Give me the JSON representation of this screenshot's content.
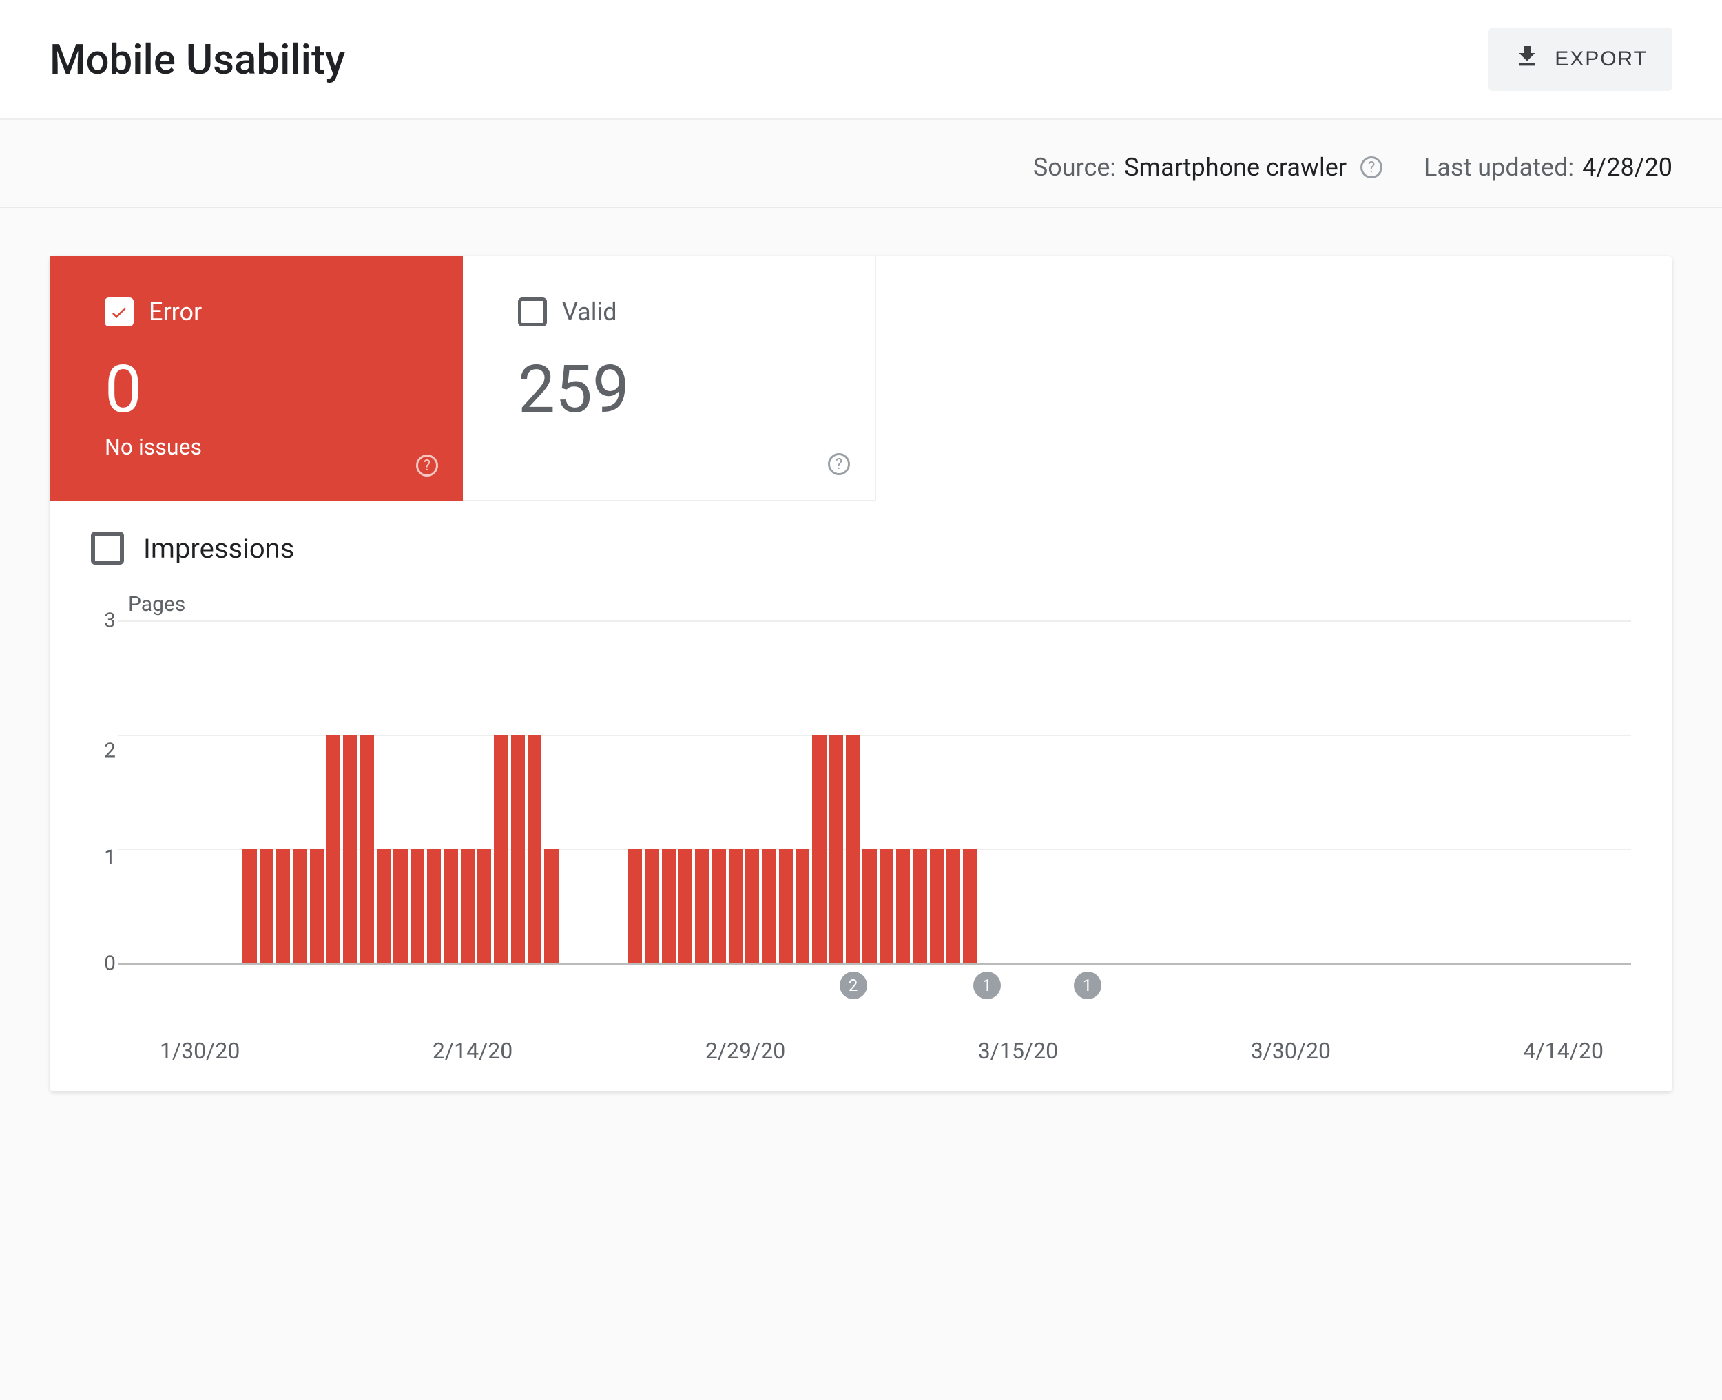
{
  "header": {
    "title": "Mobile Usability",
    "export_label": "EXPORT"
  },
  "meta": {
    "source_label": "Source:",
    "source_value": "Smartphone crawler",
    "updated_label": "Last updated:",
    "updated_value": "4/28/20"
  },
  "tabs": {
    "error": {
      "label": "Error",
      "value": "0",
      "sub": "No issues"
    },
    "valid": {
      "label": "Valid",
      "value": "259"
    }
  },
  "impressions_label": "Impressions",
  "chart_data": {
    "type": "bar",
    "ylabel": "Pages",
    "ylim": [
      0,
      3
    ],
    "y_ticks": [
      3,
      2,
      1,
      0
    ],
    "x_ticks": [
      "1/30/20",
      "2/14/20",
      "2/29/20",
      "3/15/20",
      "3/30/20",
      "4/14/20"
    ],
    "x_start": "1/30/20",
    "x_end": "4/28/20",
    "values": [
      0,
      0,
      0,
      0,
      0,
      0,
      0,
      1,
      1,
      1,
      1,
      1,
      2,
      2,
      2,
      1,
      1,
      1,
      1,
      1,
      1,
      1,
      2,
      2,
      2,
      1,
      0,
      0,
      0,
      0,
      1,
      1,
      1,
      1,
      1,
      1,
      1,
      1,
      1,
      1,
      1,
      2,
      2,
      2,
      1,
      1,
      1,
      1,
      1,
      1,
      1,
      0,
      0,
      0,
      0,
      0,
      0,
      0,
      0,
      0,
      0,
      0,
      0,
      0,
      0,
      0,
      0,
      0,
      0,
      0,
      0,
      0,
      0,
      0,
      0,
      0,
      0,
      0,
      0,
      0,
      0,
      0,
      0,
      0,
      0,
      0,
      0,
      0,
      0,
      0
    ],
    "markers": [
      {
        "label": "2",
        "index": 43
      },
      {
        "label": "1",
        "index": 51
      },
      {
        "label": "1",
        "index": 57
      }
    ]
  }
}
